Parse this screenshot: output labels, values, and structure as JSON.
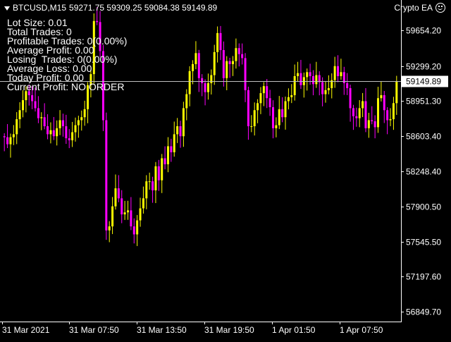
{
  "header": {
    "symbol": "BTCUSD,M15",
    "ohlc": "59271.75 59309.25 59084.38 59149.89",
    "ea_name": "Crypto EA"
  },
  "info_panel": {
    "lot_size": "Lot Size: 0.01",
    "total_trades": "Total Trades: 0",
    "profitable_trades": "Profitable Trades: 0(0.00%)",
    "average_profit": "Average Profit: 0.00",
    "losing_trades": "Losing  Trades: 0(0.00%)",
    "average_loss": "Average Loss: 0.00",
    "today_profit": "Today Profit: 0.00",
    "current_profit": "Current Profit: NO ORDER"
  },
  "colors": {
    "background": "#000000",
    "bull": "#ffff00",
    "bear": "#ff00ff",
    "axis": "#ffffff",
    "price_line": "#c0c0c0"
  },
  "icons": {
    "dropdown": "triangle-down-icon",
    "ea_status": "smiley-icon"
  },
  "chart_data": {
    "type": "candlestick",
    "y_ticks": [
      "59654.20",
      "59299.20",
      "58951.30",
      "58603.40",
      "58248.40",
      "57900.50",
      "57545.50",
      "57197.60",
      "56849.70"
    ],
    "x_ticks": [
      "31 Mar 2021",
      "31 Mar 07:50",
      "31 Mar 13:50",
      "31 Mar 19:50",
      "1 Apr 01:50",
      "1 Apr 07:50"
    ],
    "current_price": "59149.89",
    "ylim": [
      56750,
      59960
    ],
    "close": [
      58590,
      58520,
      58590,
      58620,
      58770,
      58860,
      58960,
      59050,
      59010,
      58950,
      58880,
      58780,
      58790,
      58700,
      58620,
      58660,
      58600,
      58680,
      58760,
      58700,
      58580,
      58560,
      58640,
      58710,
      58760,
      58790,
      58870,
      59110,
      59220,
      59750,
      59740,
      59450,
      58760,
      57660,
      57700,
      57900,
      58080,
      57980,
      57820,
      57840,
      57860,
      57700,
      57620,
      57760,
      57880,
      57980,
      58150,
      58150,
      58060,
      58300,
      58160,
      58380,
      58320,
      58500,
      58440,
      58620,
      58700,
      58600,
      58880,
      59020,
      59250,
      59320,
      59430,
      59180,
      59130,
      59040,
      59130,
      59210,
      59440,
      59630,
      59460,
      59180,
      59350,
      59320,
      59350,
      59480,
      59420,
      59380,
      59060,
      58700,
      58700,
      58860,
      58930,
      59030,
      59100,
      58980,
      58890,
      58680,
      58710,
      58870,
      58790,
      58950,
      58990,
      59010,
      59200,
      59230,
      59110,
      59190,
      59240,
      59200,
      59120,
      59210,
      59140,
      59020,
      59060,
      59080,
      59160,
      59300,
      59200,
      59240,
      59130,
      59080,
      58880,
      58800,
      58780,
      58880,
      58950,
      58680,
      58760,
      58750,
      58690,
      58980,
      59010,
      58860,
      58760,
      58770,
      58930,
      59150
    ],
    "open": [
      58600,
      58590,
      58520,
      58590,
      58620,
      58770,
      58860,
      58960,
      59050,
      59010,
      58950,
      58880,
      58780,
      58790,
      58700,
      58620,
      58660,
      58600,
      58680,
      58760,
      58700,
      58580,
      58560,
      58640,
      58710,
      58760,
      58790,
      58870,
      59110,
      59220,
      59750,
      59740,
      59450,
      58760,
      57660,
      57700,
      57900,
      58080,
      57980,
      57820,
      57840,
      57860,
      57700,
      57620,
      57760,
      57880,
      57980,
      58150,
      58150,
      58060,
      58300,
      58160,
      58380,
      58320,
      58500,
      58440,
      58620,
      58700,
      58600,
      58880,
      59020,
      59250,
      59320,
      59430,
      59180,
      59130,
      59040,
      59130,
      59210,
      59440,
      59630,
      59460,
      59180,
      59350,
      59320,
      59350,
      59480,
      59420,
      59380,
      59060,
      58700,
      58700,
      58860,
      58930,
      59030,
      59100,
      58980,
      58890,
      58680,
      58710,
      58870,
      58790,
      58950,
      58990,
      59010,
      59200,
      59230,
      59110,
      59190,
      59240,
      59200,
      59120,
      59210,
      59140,
      59020,
      59060,
      59080,
      59160,
      59300,
      59200,
      59240,
      59130,
      59080,
      58880,
      58800,
      58780,
      58880,
      58950,
      58680,
      58760,
      58750,
      58690,
      58980,
      59010,
      58860,
      58760,
      58770,
      58930
    ]
  }
}
